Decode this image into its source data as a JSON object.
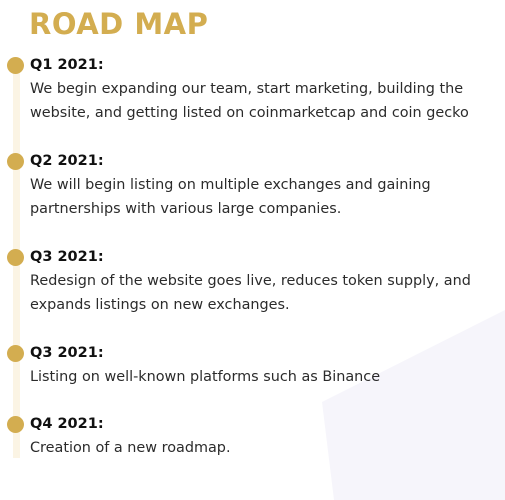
{
  "header": {
    "title": "ROAD MAP"
  },
  "colors": {
    "accent": "#d3ad50",
    "timeline": "#fbf4e4",
    "text": "#2b2b2b"
  },
  "milestones": [
    {
      "quarter": "Q1 2021:",
      "description": "We begin expanding our team, start marketing, building the website, and getting listed on coinmarketcap and coin gecko"
    },
    {
      "quarter": "Q2 2021:",
      "description": "We will begin listing on multiple exchanges and gaining partnerships with various large companies."
    },
    {
      "quarter": "Q3 2021:",
      "description": "Redesign of the website goes live, reduces token supply, and expands listings on new exchanges."
    },
    {
      "quarter": "Q3 2021:",
      "description": "Listing on well-known platforms such as Binance"
    },
    {
      "quarter": "Q4 2021:",
      "description": "Creation of a new roadmap."
    }
  ]
}
